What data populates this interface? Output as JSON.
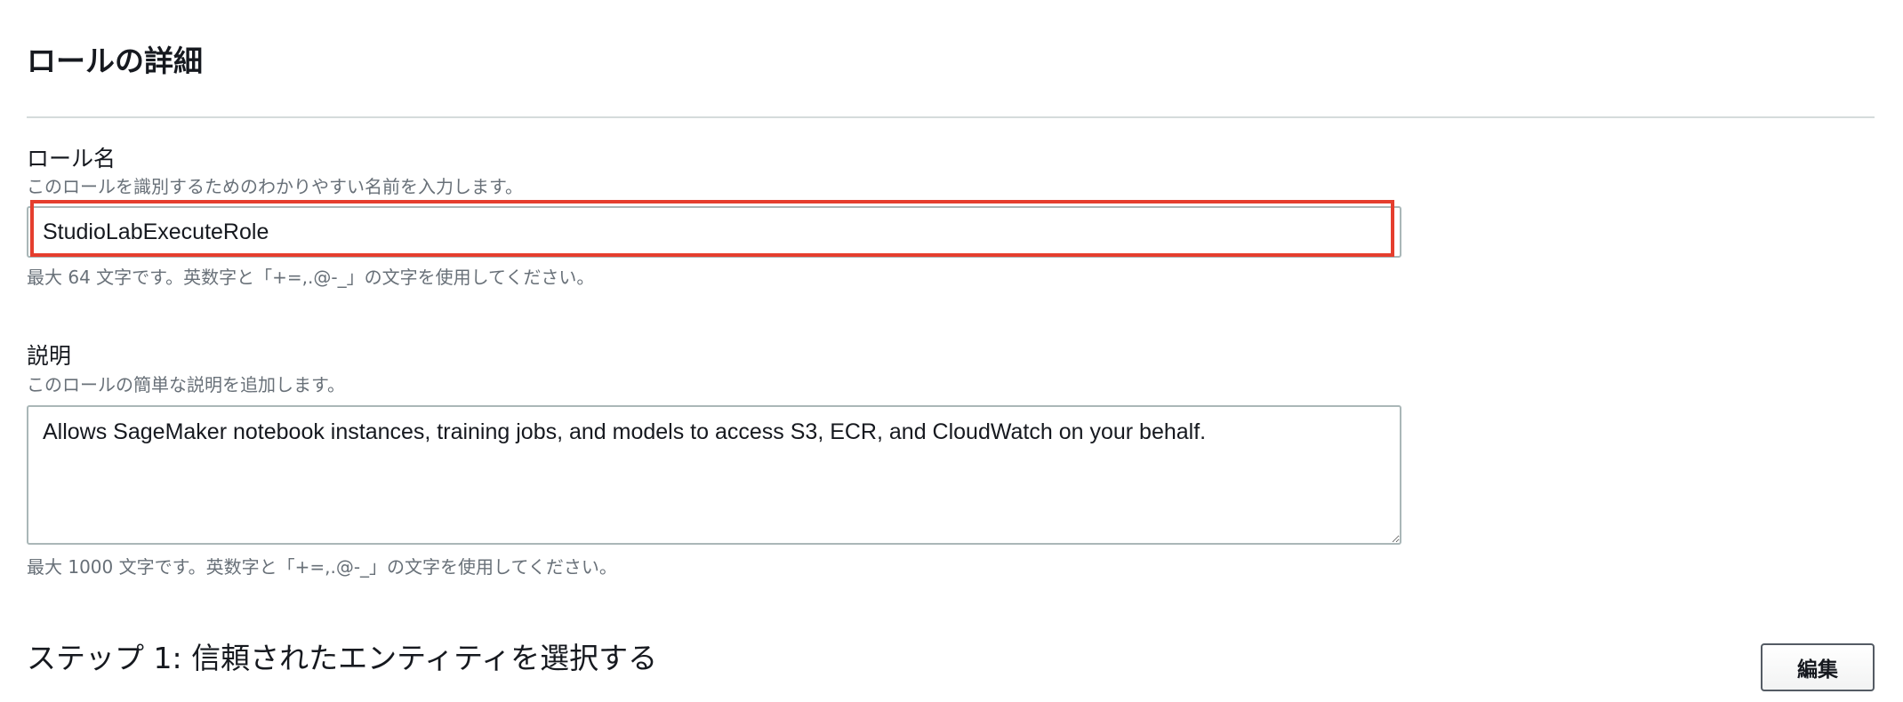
{
  "section": {
    "title": "ロールの詳細"
  },
  "role_name": {
    "label": "ロール名",
    "description": "このロールを識別するためのわかりやすい名前を入力します。",
    "value": "StudioLabExecuteRole",
    "hint": "最大 64 文字です。英数字と「+=,.@-_」の文字を使用してください。"
  },
  "description": {
    "label": "説明",
    "description": "このロールの簡単な説明を追加します。",
    "value": "Allows SageMaker notebook instances, training jobs, and models to access S3, ECR, and CloudWatch on your behalf.",
    "hint": "最大 1000 文字です。英数字と「+=,.@-_」の文字を使用してください。"
  },
  "step1": {
    "title": "ステップ 1: 信頼されたエンティティを選択する",
    "edit_label": "編集"
  },
  "colors": {
    "highlight": "#e53e2e",
    "secondary_text": "#687078",
    "border": "#aab7b8"
  }
}
